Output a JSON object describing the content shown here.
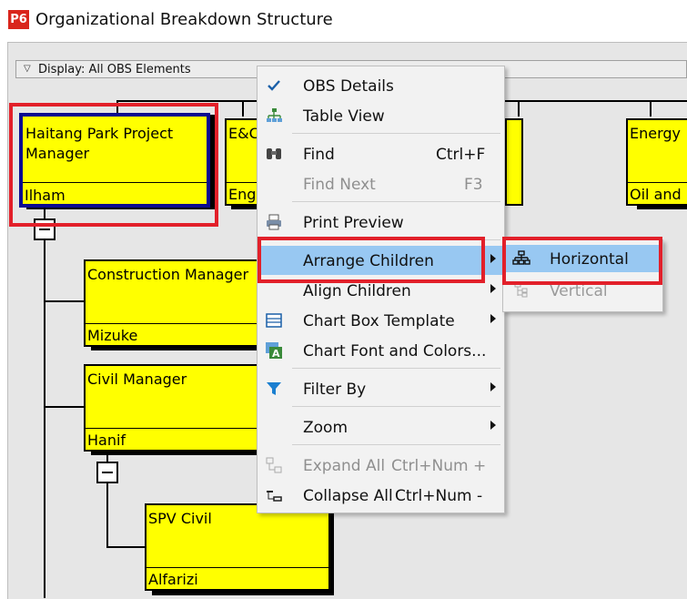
{
  "window": {
    "title": "Organizational Breakdown Structure",
    "logo": "P6",
    "logo_color": "#d9251c"
  },
  "display_bar": {
    "label": "Display: All OBS Elements"
  },
  "boxes": {
    "haitang": {
      "name": "Haitang Park Project Manager",
      "person": "Ilham"
    },
    "ec": {
      "name": "E&C",
      "person": "Eng"
    },
    "energy": {
      "name": "Energy",
      "person": "Oil and"
    },
    "construction": {
      "name": "Construction Manager",
      "person": "Mizuke"
    },
    "civil": {
      "name": "Civil Manager",
      "person": "Hanif"
    },
    "spv_civil": {
      "name": "SPV Civil",
      "person": "Alfarizi"
    }
  },
  "context_menu": {
    "items": [
      {
        "label": "OBS Details",
        "icon": "checkmark-icon"
      },
      {
        "label": "Table View",
        "icon": "tree-table-icon"
      },
      {
        "label": "Find",
        "shortcut": "Ctrl+F",
        "icon": "binoculars-icon"
      },
      {
        "label": "Find Next",
        "shortcut": "F3",
        "disabled": true
      },
      {
        "label": "Print Preview",
        "icon": "printer-icon"
      },
      {
        "label": "Arrange Children",
        "submenu": true,
        "highlighted": true
      },
      {
        "label": "Align Children",
        "submenu": true
      },
      {
        "label": "Chart Box Template",
        "icon": "template-icon",
        "submenu": true
      },
      {
        "label": "Chart Font and Colors...",
        "icon": "font-colors-icon"
      },
      {
        "label": "Filter By",
        "icon": "filter-icon",
        "submenu": true
      },
      {
        "label": "Zoom",
        "submenu": true
      },
      {
        "label": "Expand All",
        "shortcut": "Ctrl+Num +",
        "icon": "expand-all-icon",
        "disabled": true
      },
      {
        "label": "Collapse All",
        "shortcut": "Ctrl+Num -",
        "icon": "collapse-all-icon"
      }
    ]
  },
  "submenu": {
    "items": [
      {
        "label": "Horizontal",
        "icon": "horizontal-hierarchy-icon",
        "highlighted": true
      },
      {
        "label": "Vertical",
        "icon": "vertical-hierarchy-icon",
        "disabled": true
      }
    ]
  },
  "colors": {
    "box_fill": "#ffff00",
    "highlight_red": "#e2202a",
    "menu_hover": "#98c8f2",
    "selected_border": "#0a0a90"
  }
}
